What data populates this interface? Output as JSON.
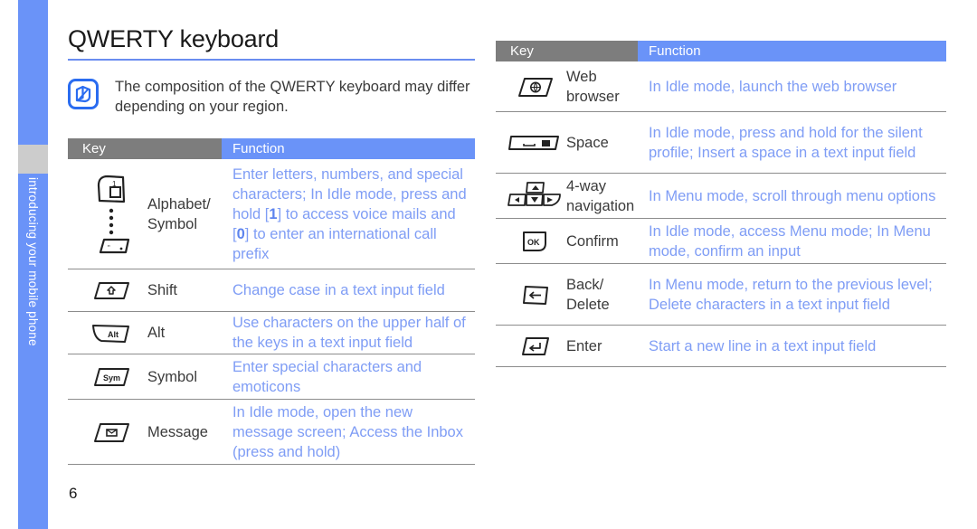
{
  "sidebar": {
    "label": "introducing your mobile phone",
    "color": "#6a93f8",
    "block_color": "#cccccc"
  },
  "page_title": "QWERTY keyboard",
  "page_number": "6",
  "note": {
    "icon": "note-pencil-icon",
    "text": "The composition of the QWERTY keyboard may differ depending on your region."
  },
  "colors": {
    "key_header_bg": "#7d7d7d",
    "function_header_bg": "#6a93f8",
    "function_text": "#7f9df5",
    "rule": "#6a8df0",
    "body_text": "#3b3b3b"
  },
  "table_left": {
    "header": {
      "key": "Key",
      "function": "Function"
    },
    "rows": [
      {
        "icon": "alphabet-symbol-key-icon",
        "name": "Alphabet/ Symbol",
        "function_parts": [
          {
            "t": "Enter letters, numbers, and special characters; In Idle mode, press and hold ["
          },
          {
            "t": "1",
            "b": true
          },
          {
            "t": "] to access voice mails and ["
          },
          {
            "t": "0",
            "b": true
          },
          {
            "t": "] to enter an international call prefix"
          }
        ],
        "function": "Enter letters, numbers, and special characters; In Idle mode, press and hold [1] to access voice mails and [0] to enter an international call prefix"
      },
      {
        "icon": "shift-key-icon",
        "name": "Shift",
        "function": "Change case in a text input field"
      },
      {
        "icon": "alt-key-icon",
        "name": "Alt",
        "function": "Use characters on the upper half of the keys in a text input field"
      },
      {
        "icon": "symbol-key-icon",
        "name": "Symbol",
        "function": "Enter special characters and emoticons"
      },
      {
        "icon": "message-key-icon",
        "name": "Message",
        "function": "In Idle mode, open the new message screen; Access the Inbox (press and hold)"
      }
    ]
  },
  "table_right": {
    "header": {
      "key": "Key",
      "function": "Function"
    },
    "rows": [
      {
        "icon": "web-browser-key-icon",
        "name": "Web browser",
        "function": "In Idle mode, launch the web browser"
      },
      {
        "icon": "space-key-icon",
        "name": "Space",
        "function": "In Idle mode, press and hold for the silent profile; Insert a space in a text input field"
      },
      {
        "icon": "four-way-navigation-key-icon",
        "name": "4-way navigation",
        "function": "In Menu mode, scroll through menu options"
      },
      {
        "icon": "confirm-key-icon",
        "name": "Confirm",
        "function": "In Idle mode, access Menu mode; In Menu mode, confirm an input"
      },
      {
        "icon": "back-delete-key-icon",
        "name": "Back/ Delete",
        "function": "In Menu mode, return to the previous level; Delete characters in a text input field"
      },
      {
        "icon": "enter-key-icon",
        "name": "Enter",
        "function": "Start a new line in a text input field"
      }
    ]
  }
}
